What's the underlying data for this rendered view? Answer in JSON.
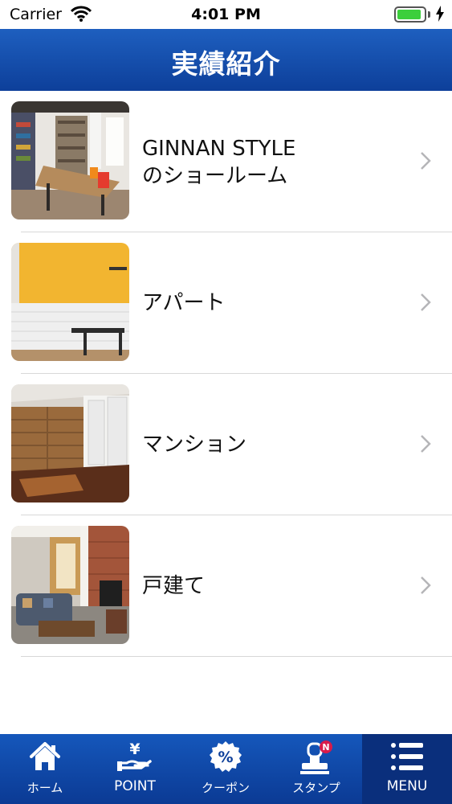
{
  "status_bar": {
    "carrier": "Carrier",
    "time": "4:01 PM",
    "battery_level": 0.9
  },
  "header": {
    "title": "実績紹介"
  },
  "list": {
    "items": [
      {
        "line1": "GINNAN STYLE",
        "line2": "のショールーム",
        "thumb": "showroom-photo"
      },
      {
        "line1": "アパート",
        "thumb": "apartment-photo"
      },
      {
        "line1": "マンション",
        "thumb": "condominium-photo"
      },
      {
        "line1": "戸建て",
        "thumb": "house-photo"
      }
    ]
  },
  "tab_bar": {
    "tabs": [
      {
        "label": "ホーム",
        "icon": "home-icon"
      },
      {
        "label": "POINT",
        "icon": "yen-hand-icon"
      },
      {
        "label": "クーポン",
        "icon": "coupon-percent-icon"
      },
      {
        "label": "スタンプ",
        "icon": "stamp-icon",
        "badge": "N"
      },
      {
        "label": "MENU",
        "icon": "menu-icon"
      }
    ],
    "active_index": 4
  },
  "colors": {
    "header_blue": "#1e5fbf",
    "tab_blue": "#0b3a94",
    "badge_red": "#d81b4a"
  }
}
